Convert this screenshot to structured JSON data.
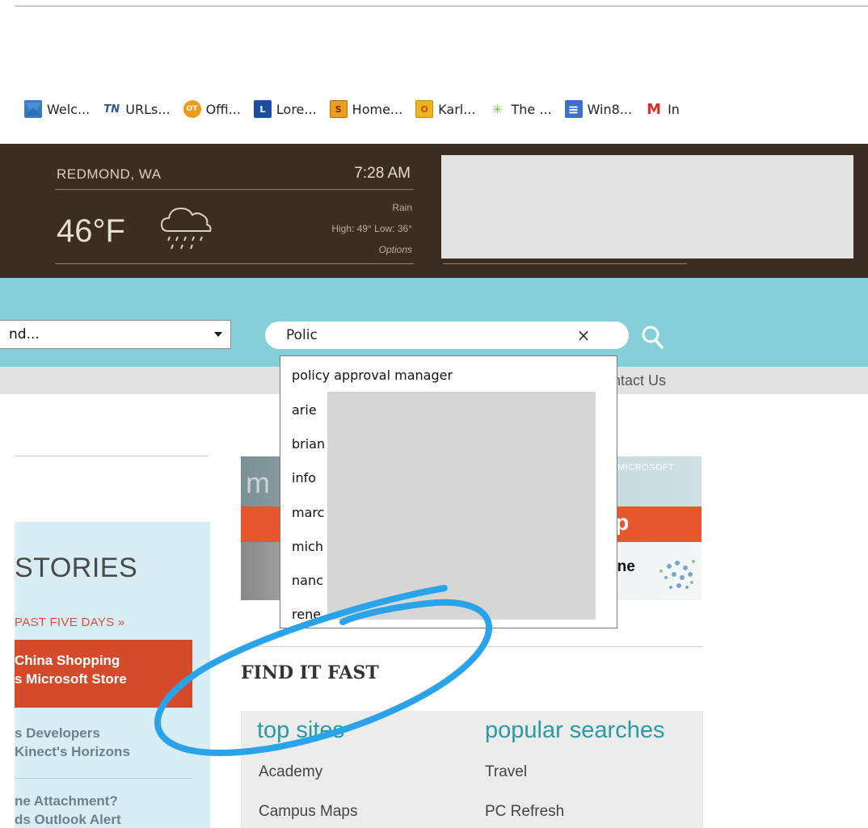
{
  "bookmarks": [
    {
      "label": "Welc...",
      "icon": "welcome-icon",
      "color": "#3a7bbf"
    },
    {
      "label": "URLs...",
      "icon": "tn-icon",
      "color": "#2e5a8c",
      "glyph": "TN"
    },
    {
      "label": "Offi...",
      "icon": "ot-icon",
      "color": "#f29a1a",
      "glyph": "OT"
    },
    {
      "label": "Lore...",
      "icon": "l-icon",
      "color": "#1c4e9c",
      "glyph": "L"
    },
    {
      "label": "Home...",
      "icon": "s-icon",
      "color": "#e7a020",
      "glyph": "S"
    },
    {
      "label": "Karl...",
      "icon": "outlook-icon",
      "color": "#f0b320",
      "glyph": "O"
    },
    {
      "label": "The ...",
      "icon": "sparkle-icon",
      "color": "#7bc043",
      "glyph": "✳"
    },
    {
      "label": "Win8...",
      "icon": "document-icon",
      "color": "#3f6fcc",
      "glyph": "≡"
    },
    {
      "label": "In",
      "icon": "gmail-icon",
      "color": "#d93025",
      "glyph": "M"
    }
  ],
  "weather": {
    "city": "REDMOND, WA",
    "time": "7:28 AM",
    "temperature": "46°F",
    "condition": "Rain",
    "high_low": "High: 49°  Low: 36°",
    "options": "Options",
    "icon": "rain-cloud-icon"
  },
  "search": {
    "scope_value": "nd...",
    "query": "Polic",
    "clear": "×",
    "go_icon": "search-icon"
  },
  "nav": {
    "contact": "ntact Us"
  },
  "suggestions": [
    "policy approval manager",
    "arie",
    "brian",
    "info",
    "marc",
    "mich",
    "nanc",
    "rene"
  ],
  "stories": {
    "title": "STORIES",
    "past": "PAST FIVE DAYS »",
    "items": [
      {
        "line1": "China Shopping",
        "line2": "s Microsoft Store"
      },
      {
        "line1": "s Developers",
        "line2": "Kinect's Horizons"
      },
      {
        "line1": "ne Attachment?",
        "line2": "ds Outlook Alert"
      }
    ]
  },
  "promo": {
    "logo": "m",
    "brand": "MICROSOFT",
    "pp": "pp",
    "one": "one"
  },
  "find_it_fast": {
    "title": "FIND IT FAST",
    "top_sites": {
      "heading": "top sites",
      "items": [
        "Academy",
        "Campus Maps"
      ]
    },
    "popular": {
      "heading": "popular searches",
      "items": [
        "Travel",
        "PC Refresh"
      ]
    }
  },
  "colors": {
    "weather_bg": "#3b2d22",
    "band": "#86cfd8",
    "accent_orange": "#d44b2c",
    "link_teal": "#2a9aa6",
    "annotation": "#2aa3ea"
  }
}
